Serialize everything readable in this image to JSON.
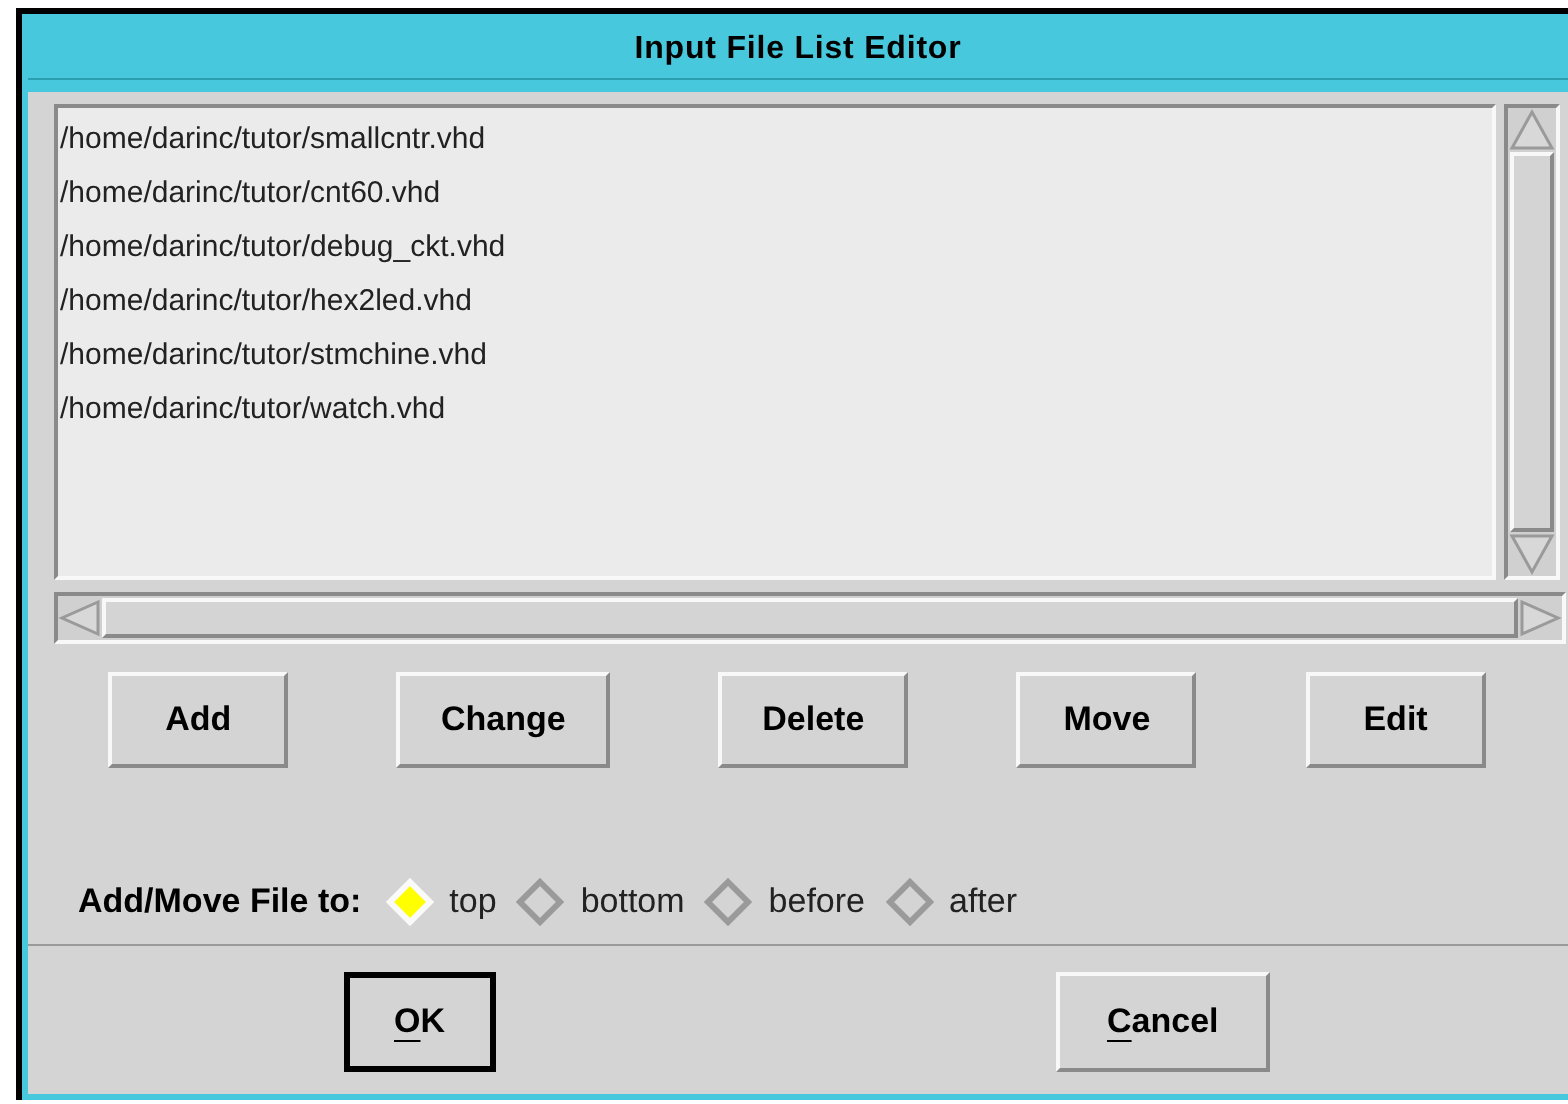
{
  "window": {
    "title": "Input File List Editor"
  },
  "files": [
    "/home/darinc/tutor/smallcntr.vhd",
    "/home/darinc/tutor/cnt60.vhd",
    "/home/darinc/tutor/debug_ckt.vhd",
    "/home/darinc/tutor/hex2led.vhd",
    "/home/darinc/tutor/stmchine.vhd",
    "/home/darinc/tutor/watch.vhd"
  ],
  "actions": [
    "Add",
    "Change",
    "Delete",
    "Move",
    "Edit"
  ],
  "position": {
    "label": "Add/Move File to:",
    "options": [
      {
        "label": "top",
        "selected": true
      },
      {
        "label": "bottom",
        "selected": false
      },
      {
        "label": "before",
        "selected": false
      },
      {
        "label": "after",
        "selected": false
      }
    ]
  },
  "dialog_buttons": [
    {
      "mnemonic": "O",
      "rest": "K",
      "default": true
    },
    {
      "mnemonic": "C",
      "rest": "ancel",
      "default": false
    }
  ]
}
